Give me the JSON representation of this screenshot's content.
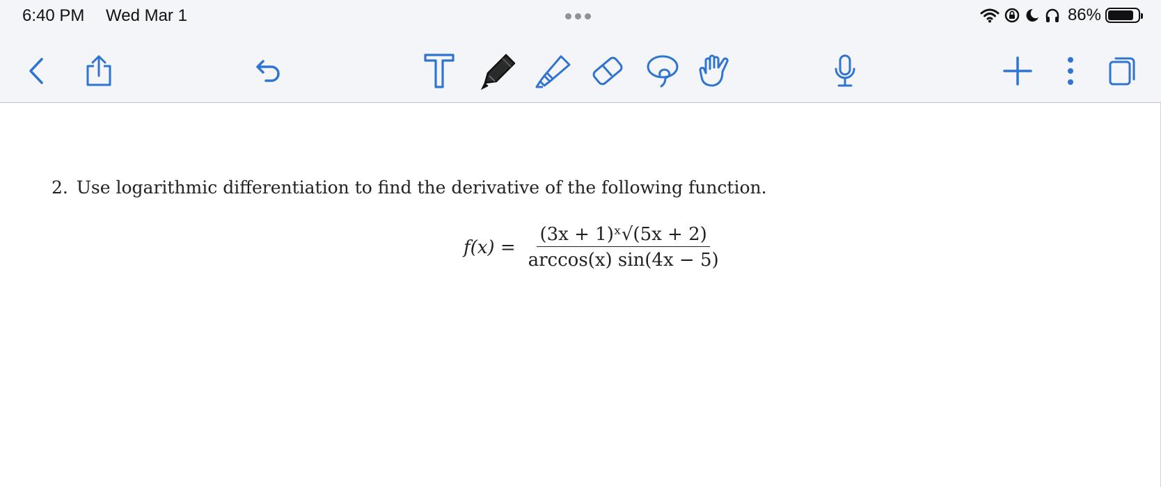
{
  "status_bar": {
    "time": "6:40 PM",
    "date": "Wed Mar 1",
    "battery": "86%",
    "battery_level": 0.86
  },
  "toolbar": {
    "accent": "#2f74d0",
    "tools": [
      {
        "name": "back-icon"
      },
      {
        "name": "share-icon"
      },
      {
        "name": "undo-icon"
      },
      {
        "name": "text-tool-icon"
      },
      {
        "name": "pen-tool-icon",
        "selected": true
      },
      {
        "name": "highlighter-tool-icon"
      },
      {
        "name": "eraser-tool-icon"
      },
      {
        "name": "lasso-tool-icon"
      },
      {
        "name": "hand-tool-icon"
      },
      {
        "name": "microphone-icon"
      },
      {
        "name": "add-icon"
      },
      {
        "name": "more-icon"
      },
      {
        "name": "pages-icon"
      }
    ]
  },
  "document": {
    "problem_number": "2.",
    "problem_text": "Use logarithmic differentiation to find the derivative of the following function.",
    "formula": {
      "lhs": "f(x) =",
      "numerator": "(3x + 1)ˣ√(5x + 2)",
      "denominator": "arccos(x) sin(4x − 5)"
    }
  }
}
